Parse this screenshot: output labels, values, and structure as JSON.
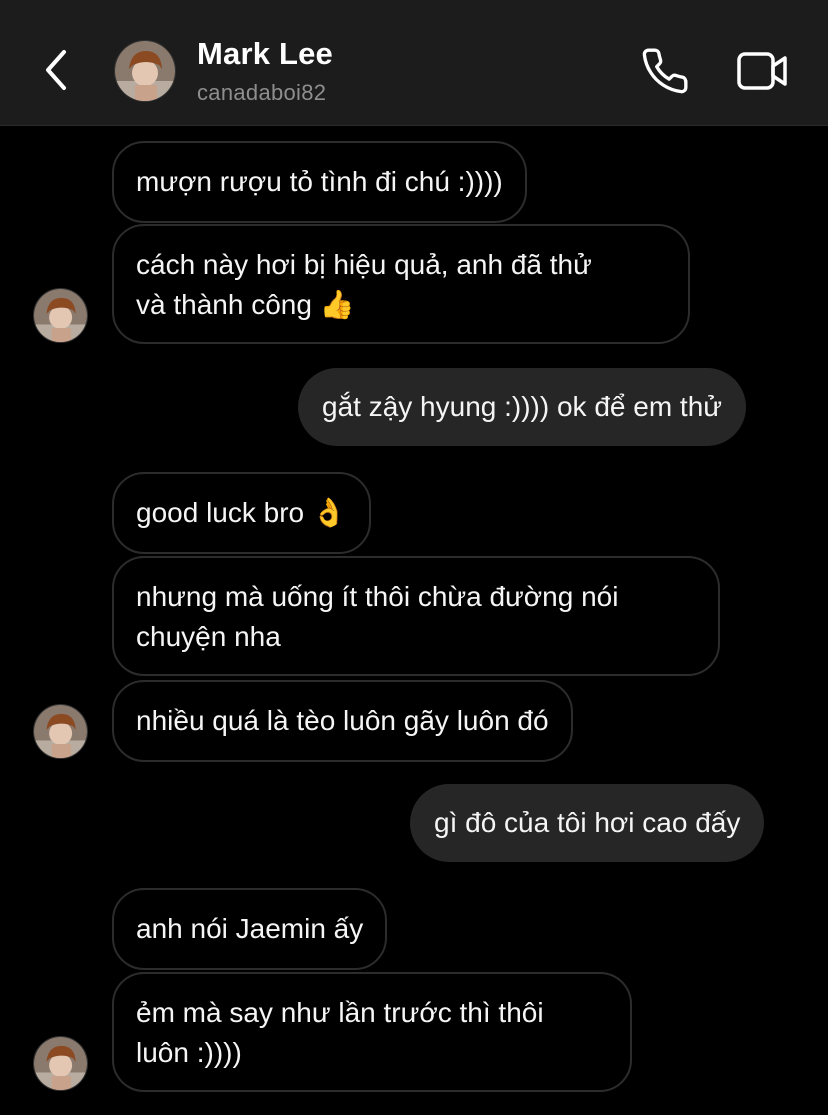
{
  "header": {
    "name": "Mark Lee",
    "username": "canadaboi82"
  },
  "messages": [
    {
      "side": "in",
      "text": "mượn rượu tỏ tình đi chú :))))"
    },
    {
      "side": "in",
      "line1": "cách này hơi bị hiệu quả, anh đã thử",
      "line2": "và thành công",
      "emoji": "👍"
    },
    {
      "side": "out",
      "text": "gắt zậy hyung :)))) ok để em thử"
    },
    {
      "side": "in",
      "text": "good luck bro",
      "emoji": "👌"
    },
    {
      "side": "in",
      "line1": "nhưng mà uống ít thôi chừa đường nói",
      "line2": "chuyện nha"
    },
    {
      "side": "in",
      "text": "nhiều quá là tèo luôn gãy luôn đó"
    },
    {
      "side": "out",
      "text": "gì đô của tôi hơi cao đấy"
    },
    {
      "side": "in",
      "text": "anh nói Jaemin ấy"
    },
    {
      "side": "in",
      "line1": "ẻm mà say như lần trước thì thôi",
      "line2": "luôn :))))"
    }
  ],
  "icons": {
    "back": "chevron-left-icon",
    "call": "phone-icon",
    "video": "video-camera-icon"
  },
  "colors": {
    "background": "#000000",
    "header": "#1c1c1c",
    "outgoing_bubble": "#262626",
    "incoming_border": "#2c2c2c",
    "secondary_text": "#8e8e8e"
  }
}
